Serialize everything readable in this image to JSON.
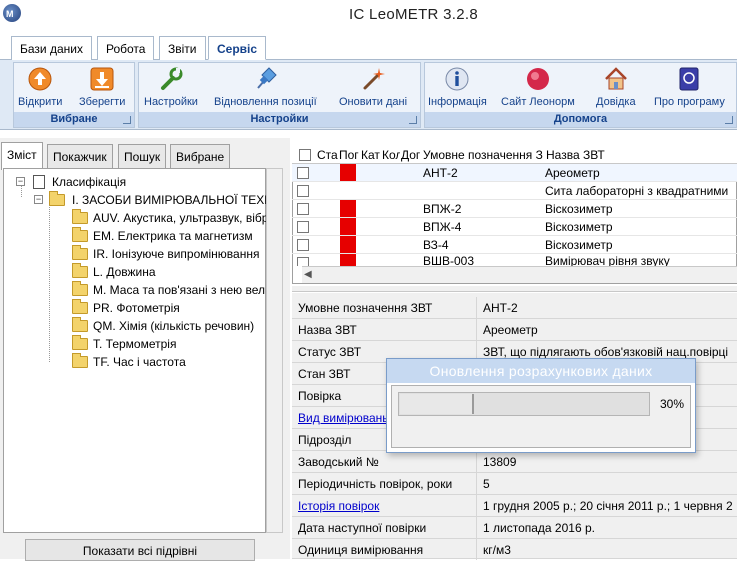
{
  "window": {
    "title": "IC LeoMETR 3.2.8"
  },
  "ribbon": {
    "tabs": [
      {
        "label": "Бази даних"
      },
      {
        "label": "Робота"
      },
      {
        "label": "Звіти"
      },
      {
        "label": "Сервіс"
      }
    ],
    "active_tab": "Сервіс",
    "groups": {
      "favorites": {
        "title": "Вибране",
        "buttons": [
          {
            "label": "Відкрити",
            "icon": "open-up-icon"
          },
          {
            "label": "Зберегти",
            "icon": "save-down-icon"
          }
        ]
      },
      "settings": {
        "title": "Настройки",
        "buttons": [
          {
            "label": "Настройки",
            "icon": "wrench-icon"
          },
          {
            "label": "Відновлення позиції",
            "icon": "pin-icon"
          },
          {
            "label": "Оновити дані",
            "icon": "magic-wand-icon"
          }
        ]
      },
      "help": {
        "title": "Допомога",
        "buttons": [
          {
            "label": "Інформація",
            "icon": "info-icon"
          },
          {
            "label": "Сайт Леонорм",
            "icon": "website-icon"
          },
          {
            "label": "Довідка",
            "icon": "home-help-icon"
          },
          {
            "label": "Про програму",
            "icon": "about-icon"
          }
        ]
      }
    }
  },
  "left_panel": {
    "tabs": [
      {
        "label": "Зміст"
      },
      {
        "label": "Покажчик"
      },
      {
        "label": "Пошук"
      },
      {
        "label": "Вибране"
      }
    ],
    "tree": {
      "root": "Класифікація",
      "section": "I. ЗАСОБИ ВИМІРЮВАЛЬНОЇ ТЕХН",
      "items": [
        "AUV. Акустика, ультразвук, вібр",
        "EM. Електрика та магнетизм",
        "IR. Іонізуюче випромінювання",
        "L. Довжина",
        "M. Маса та пов'язані з нею вел",
        "PR. Фотометрія",
        "QM. Хімія (кількість речовин)",
        "T. Термометрія",
        "TF. Час і частота"
      ]
    },
    "show_all_button": "Показати всі підрівні"
  },
  "grid": {
    "headers": [
      "Ста",
      "Пог",
      "Кат",
      "Кол",
      "Дог",
      "Умовне позначення З",
      "Назва ЗВТ"
    ],
    "rows": [
      {
        "code": "АНТ-2",
        "name": "Ареометр",
        "status_red": true
      },
      {
        "code": "",
        "name": "Сита лабораторні з квадратними",
        "status_red": false
      },
      {
        "code": "ВПЖ-2",
        "name": "Віскозиметр",
        "status_red": true
      },
      {
        "code": "ВПЖ-4",
        "name": "Віскозиметр",
        "status_red": true
      },
      {
        "code": "ВЗ-4",
        "name": "Віскозиметр",
        "status_red": true
      },
      {
        "code": "ВШВ-003",
        "name": "Вимірювач рівня звуку",
        "status_red": true
      }
    ]
  },
  "properties": [
    {
      "key": "Умовне позначення ЗВТ",
      "value": "АНТ-2",
      "link": false
    },
    {
      "key": "Назва ЗВТ",
      "value": "Ареометр",
      "link": false
    },
    {
      "key": "Статус ЗВТ",
      "value": "ЗВТ, що підлягають обов'язковій нац.повірці",
      "link": false
    },
    {
      "key": "Стан ЗВТ",
      "value": "",
      "link": false
    },
    {
      "key": "Повірка",
      "value": "",
      "link": false
    },
    {
      "key": "Вид вимірювань",
      "value": "",
      "link": true
    },
    {
      "key": "Підрозділ",
      "value": "",
      "link": false
    },
    {
      "key": "Заводський №",
      "value": "13809",
      "link": false
    },
    {
      "key": "Періодичність повірок, роки",
      "value": "5",
      "link": false
    },
    {
      "key": "Історія повірок",
      "value": "1 грудня 2005 р.; 20 січня 2011 р.; 1 червня 2",
      "link": true
    },
    {
      "key": "Дата наступної повірки",
      "value": "1 листопада 2016 р.",
      "link": false
    },
    {
      "key": "Одиниця вимірювання",
      "value": "кг/м3",
      "link": false
    }
  ],
  "progress_dialog": {
    "title": "Оновлення розрахункових даних",
    "percent_label": "30%",
    "fraction": 0.3
  }
}
